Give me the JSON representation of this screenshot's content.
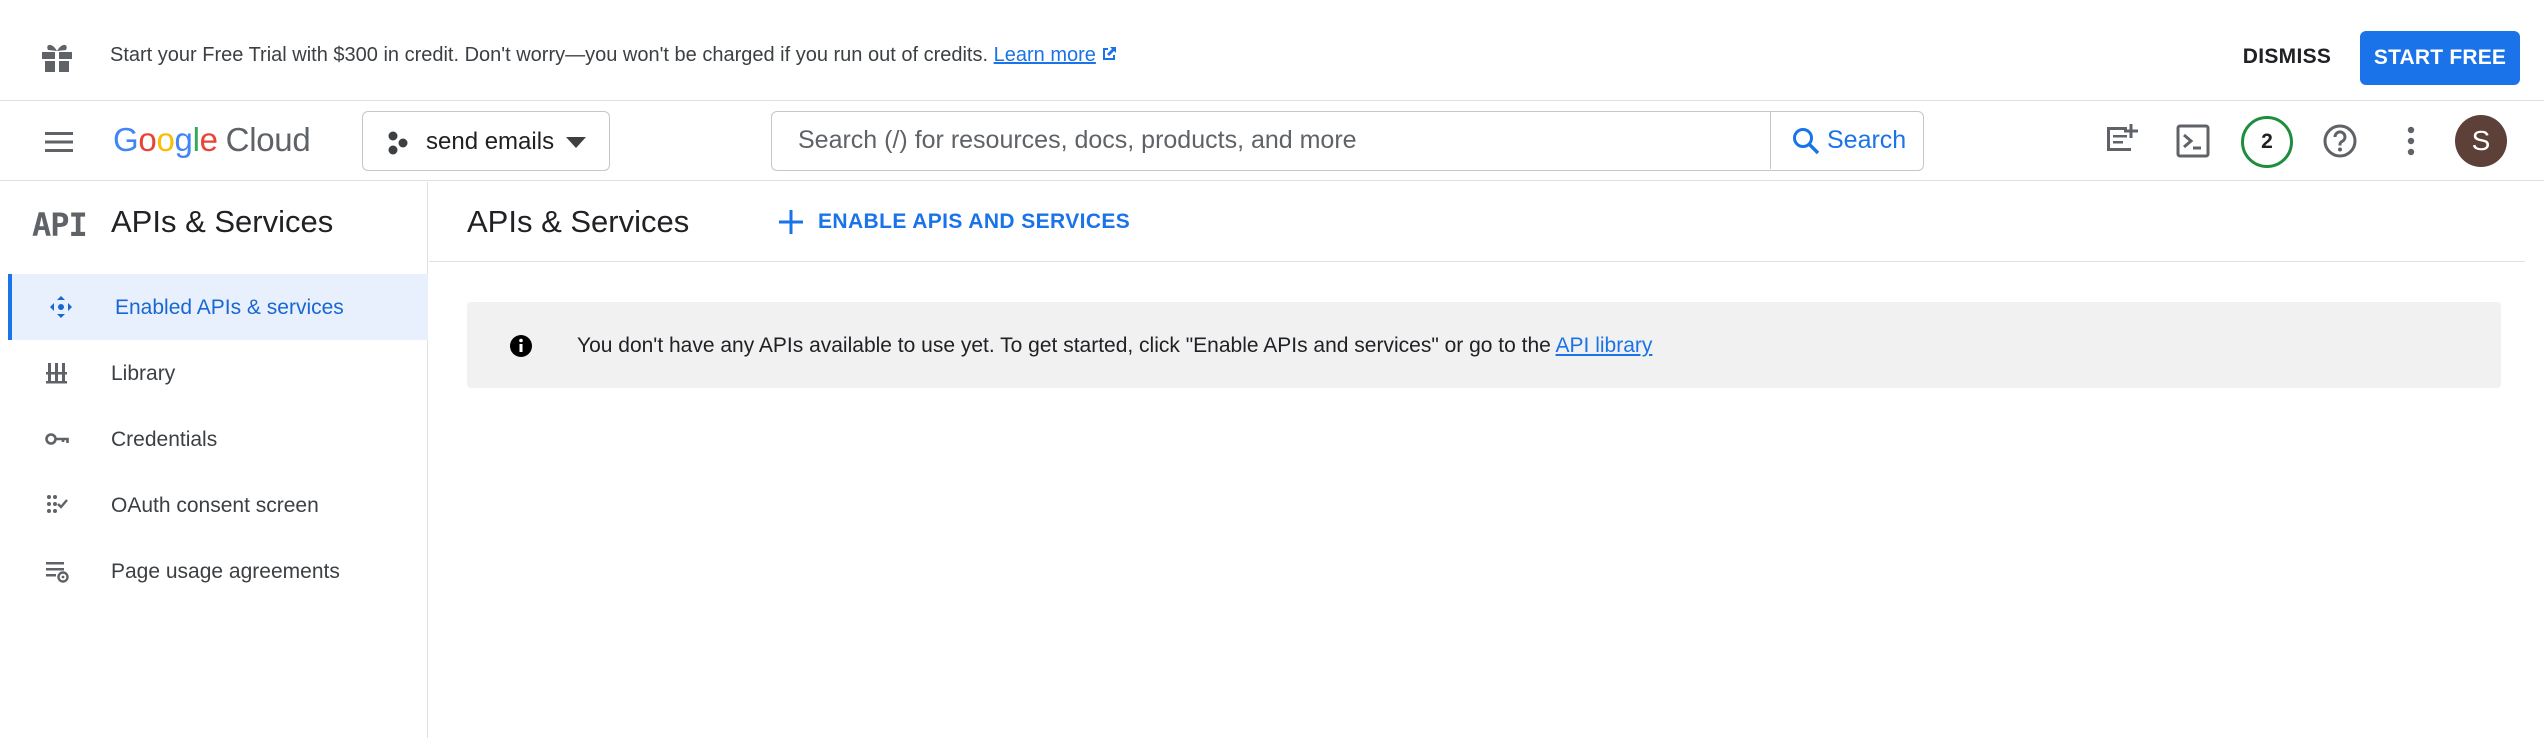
{
  "banner": {
    "message": "Start your Free Trial with $300 in credit. Don't worry—you won't be charged if you run out of credits.",
    "learn_more": "Learn more",
    "dismiss_label": "DISMISS",
    "start_label": "START FREE"
  },
  "topbar": {
    "logo_letters": [
      "G",
      "o",
      "o",
      "g",
      "l",
      "e"
    ],
    "logo_product": "Cloud",
    "project_name": "send emails",
    "search_placeholder": "Search (/) for resources, docs, products, and more",
    "search_button": "Search",
    "notification_count": "2",
    "avatar_initial": "S",
    "icons": [
      "menu-icon",
      "project-icon",
      "search-icon",
      "feedback-icon",
      "cloud-shell-icon",
      "help-icon",
      "more-vert-icon"
    ]
  },
  "sidebar": {
    "logo": "API",
    "title": "APIs & Services",
    "items": [
      {
        "label": "Enabled APIs & services",
        "icon": "enabled-apis-icon",
        "active": true
      },
      {
        "label": "Library",
        "icon": "library-icon",
        "active": false
      },
      {
        "label": "Credentials",
        "icon": "key-icon",
        "active": false
      },
      {
        "label": "OAuth consent screen",
        "icon": "oauth-icon",
        "active": false
      },
      {
        "label": "Page usage agreements",
        "icon": "settings-list-icon",
        "active": false
      }
    ]
  },
  "main": {
    "title": "APIs & Services",
    "enable_button": "ENABLE APIS AND SERVICES",
    "info_text": "You don't have any APIs available to use yet. To get started, click \"Enable APIs and services\" or go to the",
    "info_link": "API library"
  },
  "colors": {
    "accent": "#1a73e8",
    "active_nav_bg": "#e8f0fe",
    "notification_ring": "#1e8e3e",
    "avatar_bg": "#5d4037",
    "info_bg": "#f1f1f1"
  }
}
